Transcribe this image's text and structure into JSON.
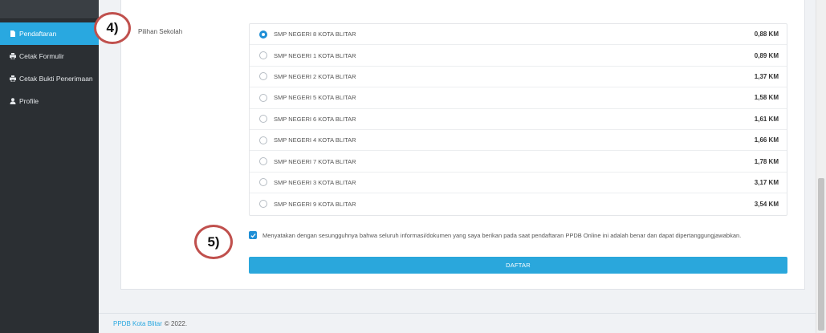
{
  "sidebar": {
    "items": [
      {
        "label": "Pendaftaran",
        "icon": "file-icon",
        "active": true
      },
      {
        "label": "Cetak Formulir",
        "icon": "print-icon",
        "active": false
      },
      {
        "label": "Cetak Bukti Penerimaan",
        "icon": "print-icon",
        "active": false
      },
      {
        "label": "Profile",
        "icon": "user-icon",
        "active": false
      }
    ]
  },
  "form": {
    "school_label": "Pilihan Sekolah",
    "schools": [
      {
        "name": "SMP NEGERI 8 KOTA BLITAR",
        "distance": "0,88 KM",
        "selected": true
      },
      {
        "name": "SMP NEGERI 1 KOTA BLITAR",
        "distance": "0,89 KM",
        "selected": false
      },
      {
        "name": "SMP NEGERI 2 KOTA BLITAR",
        "distance": "1,37 KM",
        "selected": false
      },
      {
        "name": "SMP NEGERI 5 KOTA BLITAR",
        "distance": "1,58 KM",
        "selected": false
      },
      {
        "name": "SMP NEGERI 6 KOTA BLITAR",
        "distance": "1,61 KM",
        "selected": false
      },
      {
        "name": "SMP NEGERI 4 KOTA BLITAR",
        "distance": "1,66 KM",
        "selected": false
      },
      {
        "name": "SMP NEGERI 7 KOTA BLITAR",
        "distance": "1,78 KM",
        "selected": false
      },
      {
        "name": "SMP NEGERI 3 KOTA BLITAR",
        "distance": "3,17 KM",
        "selected": false
      },
      {
        "name": "SMP NEGERI 9 KOTA BLITAR",
        "distance": "3,54 KM",
        "selected": false
      }
    ],
    "agreement_checked": true,
    "agreement_text": "Menyatakan dengan sesungguhnya bahwa seluruh informasi/dokumen yang saya berikan pada saat pendaftaran PPDB Online ini adalah benar dan dapat dipertanggungjawabkan.",
    "submit_label": "DAFTAR"
  },
  "footer": {
    "link_text": "PPDB Kota Blitar",
    "copyright": "© 2022."
  },
  "annotations": {
    "step4": "4)",
    "step5": "5)"
  },
  "colors": {
    "accent": "#29a8e0",
    "sidebar_bg": "#2b2f33",
    "callout_border": "#c0504d"
  }
}
